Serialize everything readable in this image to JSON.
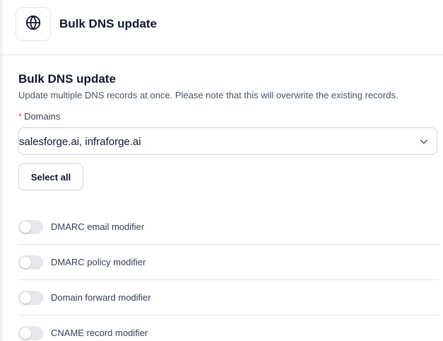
{
  "header": {
    "title": "Bulk DNS update",
    "icon": "globe-icon"
  },
  "section": {
    "title": "Bulk DNS update",
    "description": "Update multiple DNS records at once. Please note that this will overwrite the existing records."
  },
  "domains_field": {
    "required_mark": "*",
    "label": "Domains",
    "value": "salesforge.ai, infraforge.ai"
  },
  "select_all_button": {
    "label": "Select all"
  },
  "modifiers": [
    {
      "label": "DMARC email modifier",
      "enabled": false
    },
    {
      "label": "DMARC policy modifier",
      "enabled": false
    },
    {
      "label": "Domain forward modifier",
      "enabled": false
    },
    {
      "label": "CNAME record modifier",
      "enabled": false
    }
  ],
  "colors": {
    "required": "#ef4444",
    "toggle_off": "#e5e7eb",
    "border": "#d1d5db"
  }
}
